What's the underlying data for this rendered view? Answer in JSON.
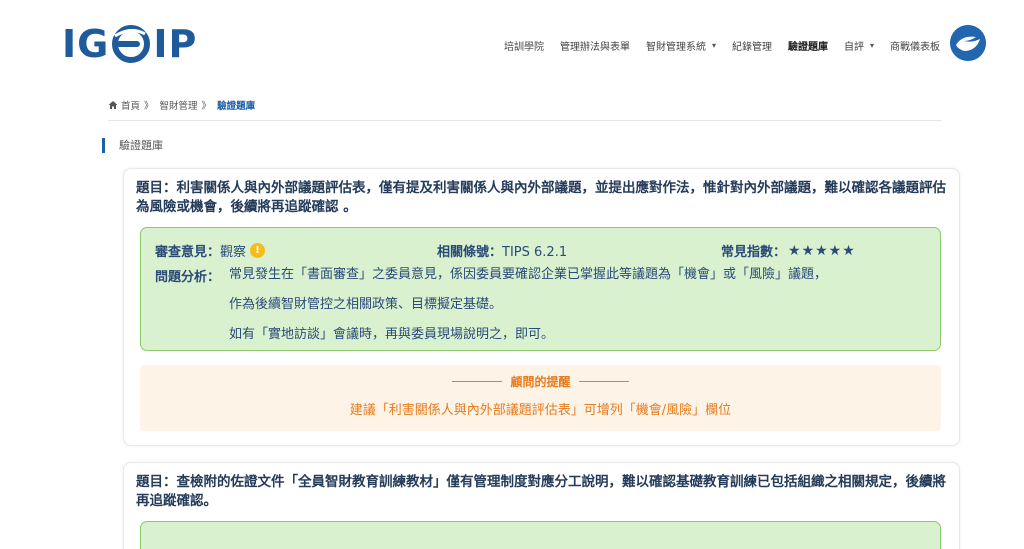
{
  "header": {
    "logo_text_left": "IG",
    "logo_text_right": "IP",
    "nav": [
      {
        "label": "培訓學院",
        "dropdown": false,
        "active": false
      },
      {
        "label": "管理辦法與表單",
        "dropdown": false,
        "active": false
      },
      {
        "label": "智財管理系統",
        "dropdown": true,
        "active": false
      },
      {
        "label": "紀錄管理",
        "dropdown": false,
        "active": false
      },
      {
        "label": "驗證題庫",
        "dropdown": false,
        "active": true
      },
      {
        "label": "自評",
        "dropdown": true,
        "active": false
      },
      {
        "label": "商戰儀表板",
        "dropdown": false,
        "active": false
      }
    ],
    "caret": "▾"
  },
  "breadcrumb": {
    "home": "首頁",
    "sep": "》",
    "middle": "智財管理",
    "current": "驗證題庫"
  },
  "section": {
    "title": "驗證題庫"
  },
  "cards": [
    {
      "question": "題目：利害關係人與內外部議題評估表，僅有提及利害關係人與內外部議題，並提出應對作法，惟針對內外部議題，難以確認各議題評估為風險或機會，後續將再追蹤確認 。",
      "review_label": "審查意見：",
      "review_value": "觀察",
      "warn_glyph": "!",
      "clause_label": "相關條號：",
      "clause_value": "TIPS 6.2.1",
      "index_label": "常見指數：",
      "stars": "★★★★★",
      "rating": 5,
      "analysis_label": "問題分析：",
      "analysis_lines": [
        "常見發生在「書面審查」之委員意見，係因委員要確認企業已掌握此等議題為「機會」或「風險」議題，",
        "作為後續智財管控之相關政策、目標擬定基礎。",
        "如有「實地訪談」會議時，再與委員現場說明之，即可。"
      ],
      "tip_title": "顧問的提醒",
      "tip_text": "建議「利害關係人與內外部議題評估表」可增列「機會/風險」欄位"
    },
    {
      "question": "題目：查檢附的佐證文件「全員智財教育訓練教材」僅有管理制度對應分工說明，難以確認基礎教育訓練已包括組織之相關規定，後續將再追蹤確認。"
    }
  ],
  "colors": {
    "brand": "#1f5a9a",
    "accent_blue": "#1f5fa8",
    "green_bg": "#d9f1cf",
    "green_border": "#8cc96d",
    "orange": "#e77b1d",
    "warn": "#f6bd1a"
  }
}
